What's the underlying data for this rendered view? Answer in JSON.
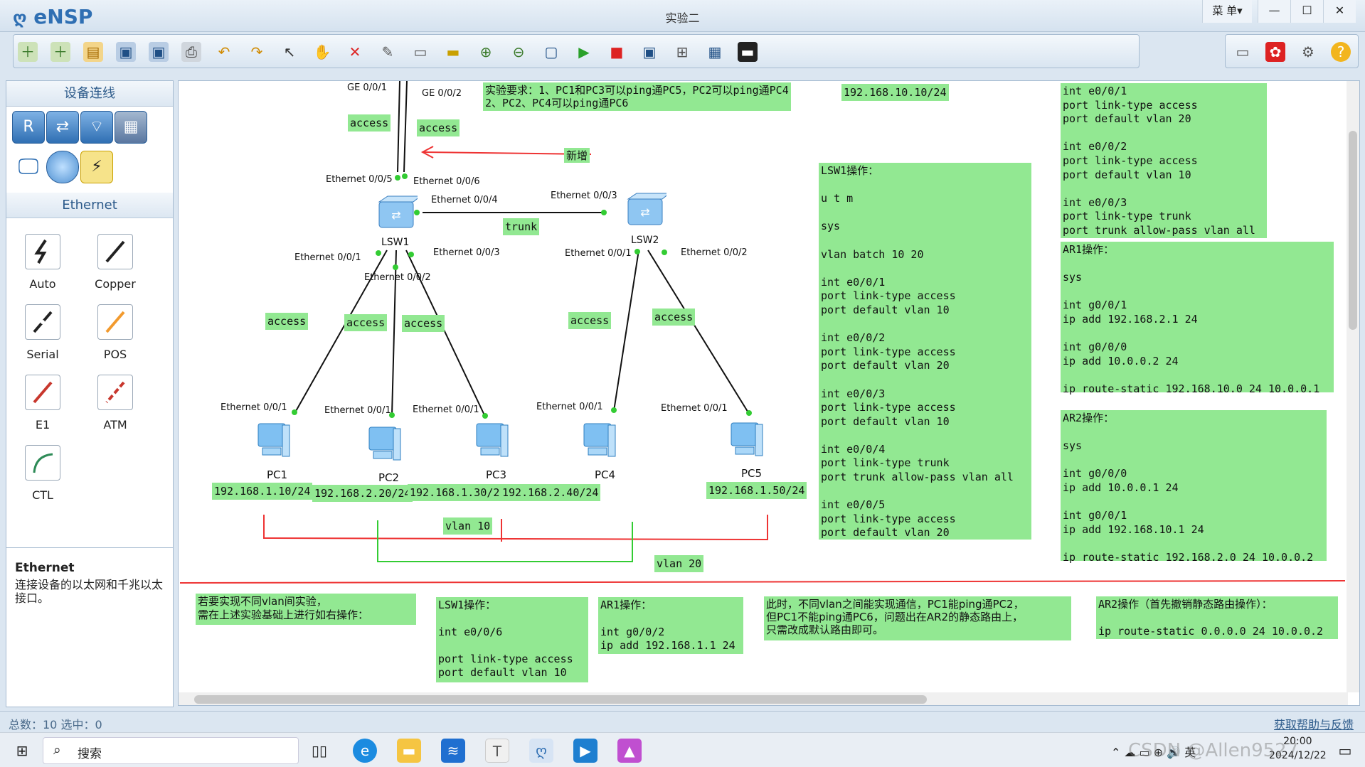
{
  "app": {
    "title": "eNSP",
    "window_title": "实验二",
    "menu": "菜 单▾",
    "min": "—",
    "max": "☐",
    "close": "✕"
  },
  "left": {
    "section1": "设备连线",
    "section2": "Ethernet",
    "cables": [
      {
        "label": "Auto"
      },
      {
        "label": "Copper"
      },
      {
        "label": "Serial"
      },
      {
        "label": "POS"
      },
      {
        "label": "E1"
      },
      {
        "label": "ATM"
      },
      {
        "label": "CTL"
      }
    ],
    "info_title": "Ethernet",
    "info_text": "连接设备的以太网和千兆以太接口。"
  },
  "canvas": {
    "requirement": "实验要求：1、PC1和PC3可以ping通PC5，PC2可以ping通PC4\n2、PC2、PC4可以ping通PC6",
    "ip_top": "192.168.10.10/24",
    "access_labels": [
      "access",
      "access",
      "access",
      "access",
      "access",
      "access",
      "access"
    ],
    "trunk": "trunk",
    "new_label": "新增",
    "switches": {
      "lsw1": "LSW1",
      "lsw2": "LSW2"
    },
    "ports": {
      "ge001": "GE 0/0/1",
      "ge002": "GE 0/0/2",
      "e05": "Ethernet 0/0/5",
      "e06": "Ethernet 0/0/6",
      "e04": "Ethernet 0/0/4",
      "e03": "Ethernet 0/0/3",
      "e03b": "Ethernet 0/0/3",
      "sw1_e01": "Ethernet 0/0/1",
      "sw1_e02": "Ethernet 0/0/2",
      "sw2_e01": "Ethernet 0/0/1",
      "sw2_e02": "Ethernet 0/0/2",
      "pc1": "Ethernet 0/0/1",
      "pc2": "Ethernet 0/0/1",
      "pc3": "Ethernet 0/0/1",
      "pc4": "Ethernet 0/0/1",
      "pc5": "Ethernet 0/0/1"
    },
    "pcs": [
      {
        "name": "PC1",
        "ip": "192.168.1.10/24"
      },
      {
        "name": "PC2",
        "ip": "192.168.2.20/24"
      },
      {
        "name": "PC3",
        "ip": "192.168.1.30/24"
      },
      {
        "name": "PC4",
        "ip": "192.168.2.40/24"
      },
      {
        "name": "PC5",
        "ip": "192.168.1.50/24"
      }
    ],
    "vlan10": "vlan 10",
    "vlan20": "vlan 20",
    "lsw1_ops": "LSW1操作：\n\nu t m\n\nsys\n\nvlan batch 10 20\n\nint e0/0/1\nport link-type access\nport default vlan 10\n\nint e0/0/2\nport link-type access\nport default vlan 20\n\nint e0/0/3\nport link-type access\nport default vlan 10\n\nint e0/0/4\nport link-type trunk\nport trunk allow-pass vlan all\n\nint e0/0/5\nport link-type access\nport default vlan 20",
    "lsw2_ops": "int e0/0/1\nport link-type access\nport default vlan 20\n\nint e0/0/2\nport link-type access\nport default vlan 10\n\nint e0/0/3\nport link-type trunk\nport trunk allow-pass vlan all",
    "ar1_ops": "AR1操作：\n\nsys\n\nint g0/0/1\nip add 192.168.2.1 24\n\nint g0/0/0\nip add 10.0.0.2 24\n\nip route-static 192.168.10.0 24 10.0.0.1",
    "ar2_ops": "AR2操作：\n\nsys\n\nint g0/0/0\nip add 10.0.0.1 24\n\nint g0/0/1\nip add 192.168.10.1 24\n\nip route-static 192.168.2.0 24 10.0.0.2",
    "bottom_intro": "若要实现不同vlan间实验，\n需在上述实验基础上进行如右操作：",
    "bottom_lsw1": "LSW1操作：\n\nint e0/0/6\n\nport link-type access\nport default vlan 10",
    "bottom_ar1": "AR1操作：\n\nint g0/0/2\nip add 192.168.1.1 24",
    "bottom_note": "此时，不同vlan之间能实现通信，PC1能ping通PC2，\n但PC1不能ping通PC6，问题出在AR2的静态路由上，\n只需改成默认路由即可。",
    "bottom_ar2": "AR2操作（首先撤销静态路由操作）：\n\nip route-static 0.0.0.0 24 10.0.0.2"
  },
  "status": {
    "left": "总数：10 选中：0",
    "right": "获取帮助与反馈"
  },
  "taskbar": {
    "search": "搜索",
    "time": "20:00",
    "date": "2024/12/22",
    "ime": "英",
    "watermark": "CSDN @Allen9527"
  }
}
